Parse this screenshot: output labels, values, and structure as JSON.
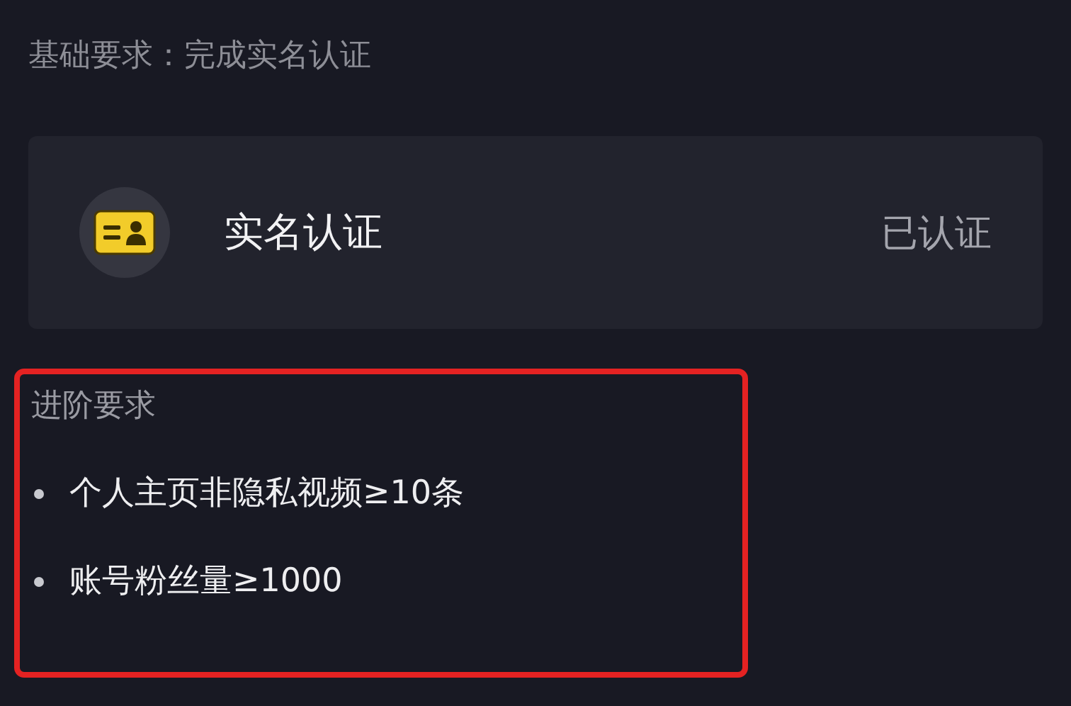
{
  "basic_requirement": "基础要求：完成实名认证",
  "verification_card": {
    "title": "实名认证",
    "status": "已认证"
  },
  "advanced": {
    "title": "进阶要求",
    "items": [
      "个人主页非隐私视频≥10条",
      "账号粉丝量≥1000"
    ]
  }
}
